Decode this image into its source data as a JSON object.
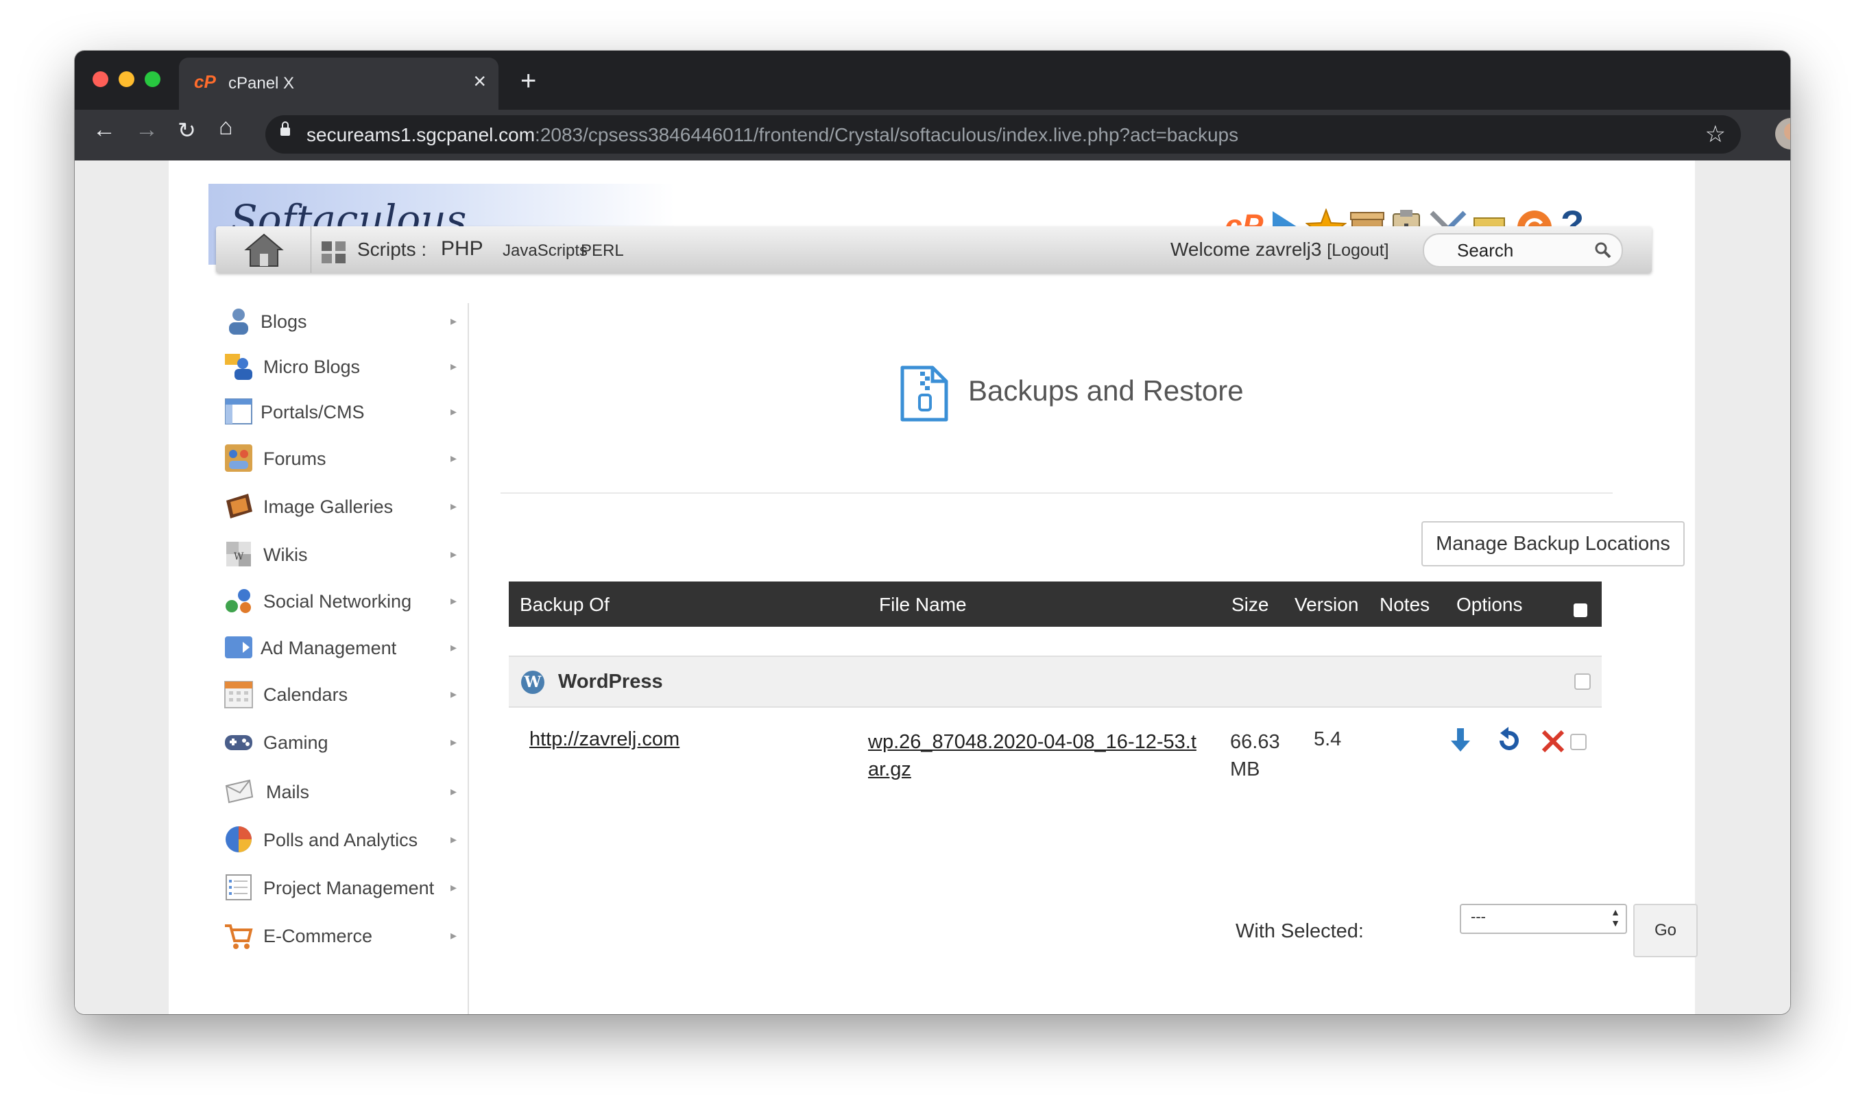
{
  "browser": {
    "tab_title": "cPanel X",
    "tab_favicon": "cP",
    "url_host": "secureams1.sgcpanel.com",
    "url_path": ":2083/cpsess3846446011/frontend/Crystal/softaculous/index.live.php?act=backups"
  },
  "header": {
    "logo_text": "Softaculous",
    "top_icons": [
      "cpanel-icon",
      "play-icon",
      "star-icon",
      "box-icon",
      "clipboard-icon",
      "tools-icon",
      "folder-arrow-icon",
      "refresh-icon",
      "help-icon"
    ],
    "help_label": "?"
  },
  "navbar": {
    "scripts_label": "Scripts :",
    "php": "PHP",
    "javascripts": "JavaScripts",
    "perl": "PERL",
    "welcome": "Welcome zavrelj3",
    "logout": "[Logout]",
    "search_label": "Search"
  },
  "sidebar": {
    "items": [
      {
        "label": "Blogs",
        "icon": "blogs-icon"
      },
      {
        "label": "Micro Blogs",
        "icon": "micro-blogs-icon"
      },
      {
        "label": "Portals/CMS",
        "icon": "portals-icon"
      },
      {
        "label": "Forums",
        "icon": "forums-icon"
      },
      {
        "label": "Image Galleries",
        "icon": "image-galleries-icon"
      },
      {
        "label": "Wikis",
        "icon": "wikis-icon"
      },
      {
        "label": "Social Networking",
        "icon": "social-networking-icon"
      },
      {
        "label": "Ad Management",
        "icon": "ad-management-icon"
      },
      {
        "label": "Calendars",
        "icon": "calendars-icon"
      },
      {
        "label": "Gaming",
        "icon": "gaming-icon"
      },
      {
        "label": "Mails",
        "icon": "mails-icon"
      },
      {
        "label": "Polls and Analytics",
        "icon": "polls-icon"
      },
      {
        "label": "Project Management",
        "icon": "project-management-icon"
      },
      {
        "label": "E-Commerce",
        "icon": "e-commerce-icon"
      }
    ]
  },
  "main": {
    "heading": "Backups and Restore",
    "manage_button": "Manage Backup Locations",
    "table": {
      "columns": [
        "Backup Of",
        "File Name",
        "Size",
        "Version",
        "Notes",
        "Options"
      ],
      "group": "WordPress",
      "rows": [
        {
          "backup_of": "http://zavrelj.com",
          "file_name_line1": "wp.26_87048.2020-04-08_16-12-53.t",
          "file_name_line2": "ar.gz",
          "size_line1": "66.63",
          "size_line2": "MB",
          "version": "5.4",
          "notes": ""
        }
      ]
    },
    "with_selected_label": "With Selected:",
    "with_selected_value": "---",
    "go_label": "Go"
  }
}
